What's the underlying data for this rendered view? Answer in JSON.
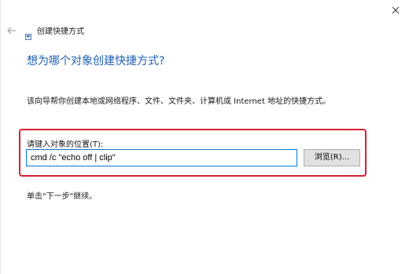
{
  "window": {
    "title": "创建快捷方式"
  },
  "page": {
    "heading": "想为哪个对象创建快捷方式?",
    "description": "该向导帮你创建本地或网络程序、文件、文件夹、计算机或 Internet 地址的快捷方式。",
    "location_label": "请键入对象的位置(T):",
    "location_value": "cmd /c \"echo off | clip\"",
    "browse_label": "浏览(R)...",
    "continue_hint": "单击\"下一步\"继续。"
  },
  "icons": {
    "close": "close-icon",
    "back": "back-arrow-icon",
    "app": "shortcut-wizard-icon"
  },
  "colors": {
    "heading": "#1f5fb3",
    "highlight_border": "#d6202f",
    "input_border": "#0078d7",
    "button_bg": "#e1e1e1"
  }
}
